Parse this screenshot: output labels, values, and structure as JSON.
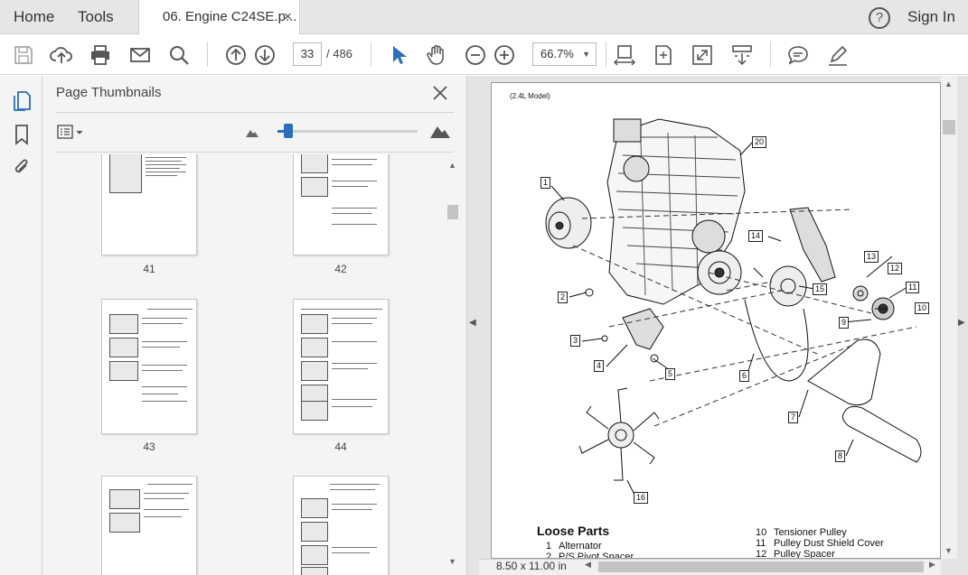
{
  "menu": {
    "home": "Home",
    "tools": "Tools",
    "sign_in": "Sign In",
    "help_icon": "?"
  },
  "tab": {
    "title": "06. Engine C24SE.p...",
    "close": "×"
  },
  "toolbar": {
    "page_current": "33",
    "page_total": "/ 486",
    "zoom": "66.7%"
  },
  "thumbnails": {
    "title": "Page Thumbnails",
    "pages": [
      "41",
      "42",
      "43",
      "44",
      "",
      ""
    ]
  },
  "document": {
    "model_label": "(2.4L Model)",
    "loose_parts_title": "Loose Parts",
    "parts_left": [
      {
        "num": "1",
        "name": "Alternator"
      },
      {
        "num": "2",
        "name": "P/S Pivot Spacer"
      }
    ],
    "parts_right": [
      {
        "num": "10",
        "name": "Tensioner Pulley"
      },
      {
        "num": "11",
        "name": "Pulley Dust Shield Cover"
      },
      {
        "num": "12",
        "name": "Pulley Spacer"
      }
    ],
    "callouts": [
      "1",
      "2",
      "3",
      "4",
      "5",
      "6",
      "7",
      "8",
      "9",
      "10",
      "11",
      "12",
      "13",
      "14",
      "15",
      "16",
      "20"
    ]
  },
  "status": {
    "page_size": "8.50 x 11.00 in"
  },
  "colors": {
    "accent": "#2a6fb8",
    "menubar": "#e6e6e6"
  }
}
